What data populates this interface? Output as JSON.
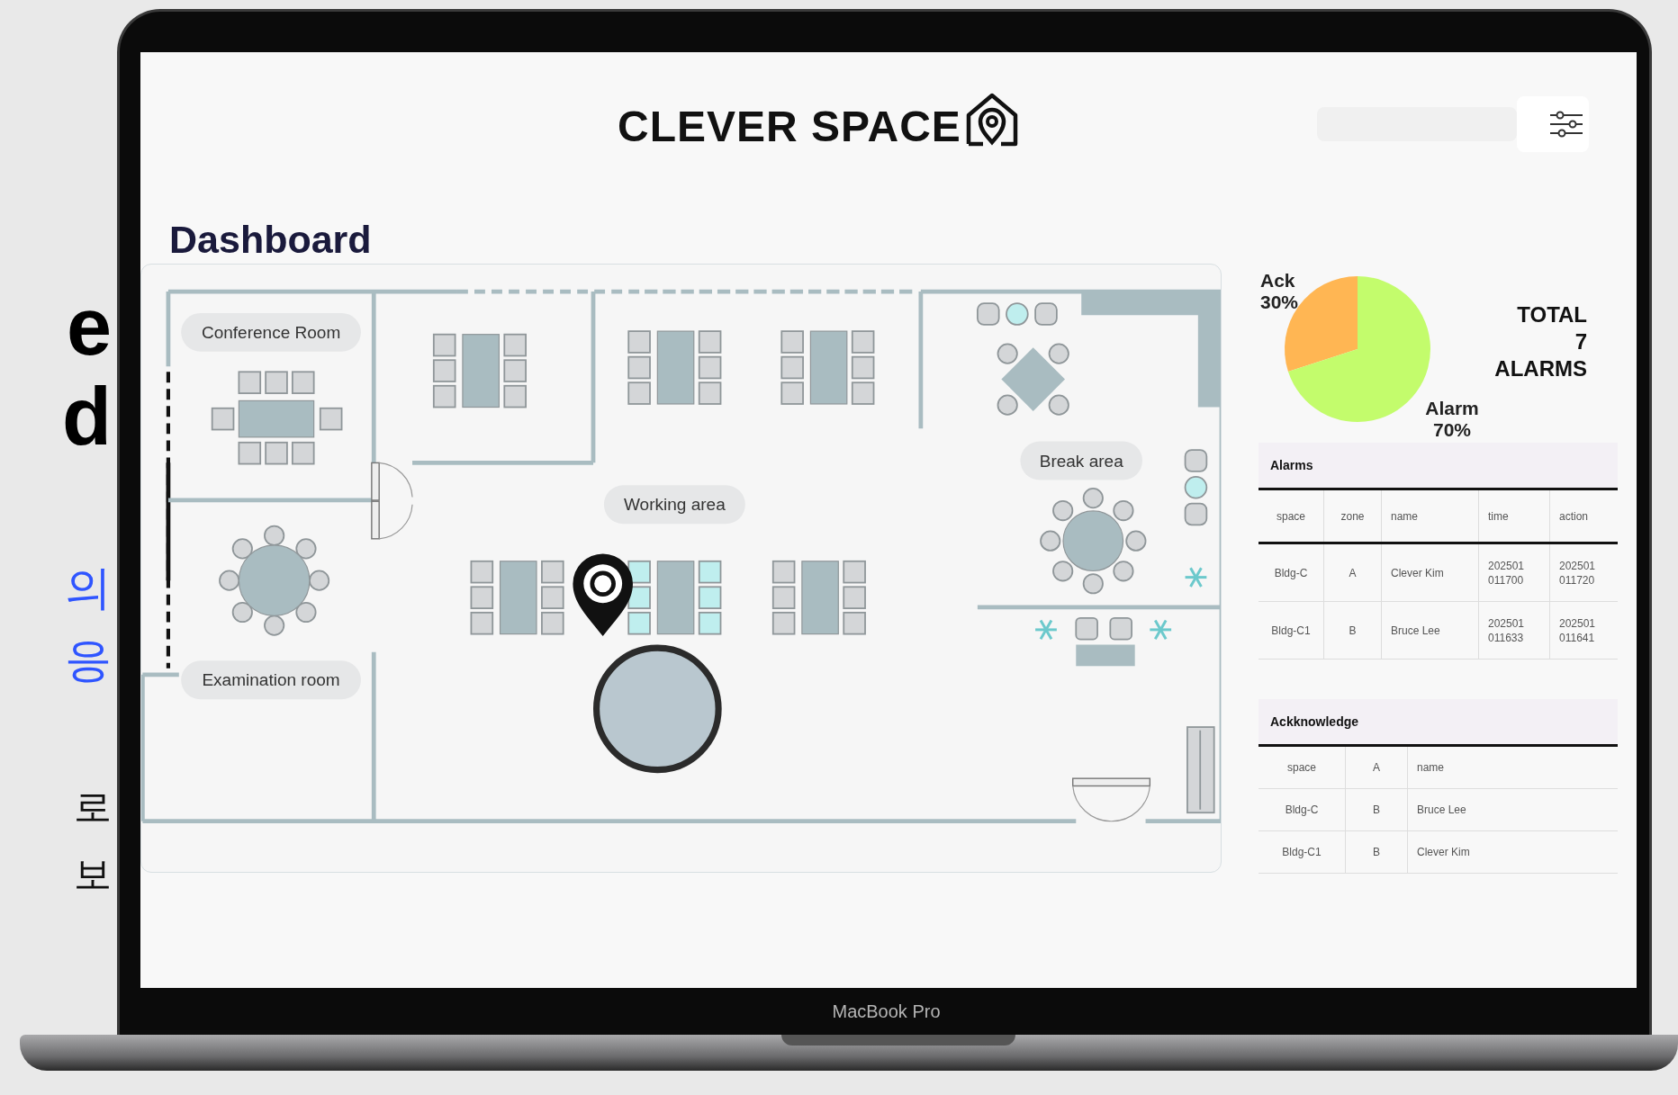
{
  "side_text": [
    {
      "text": "e",
      "kind": "heading"
    },
    {
      "text": "d",
      "kind": "heading"
    },
    {
      "text": "의",
      "kind": "link"
    },
    {
      "text": "응",
      "kind": "link"
    },
    {
      "text": "로",
      "kind": "body"
    },
    {
      "text": "보",
      "kind": "body"
    }
  ],
  "header": {
    "logo": "CLEVER SPACE"
  },
  "page_title": "Dashboard",
  "floor_plan": {
    "rooms": [
      "Conference Room",
      "Working area",
      "Break area",
      "Examination room"
    ]
  },
  "alarm_summary": {
    "chart_data": {
      "type": "pie",
      "categories": [
        "Ack",
        "Alarm"
      ],
      "values": [
        30,
        70
      ],
      "colors": [
        "#ffb653",
        "#c3fc6c"
      ],
      "value_labels": [
        "30%",
        "70%"
      ]
    },
    "total": [
      "TOTAL",
      "7",
      "ALARMS"
    ]
  },
  "alarms_table": {
    "title": "Alarms",
    "columns": [
      "space",
      "zone",
      "name",
      "time",
      "action"
    ],
    "rows": [
      [
        "Bldg-C",
        "A",
        "Clever Kim",
        "202501 011700",
        "202501 011720"
      ],
      [
        "Bldg-C1",
        "B",
        "Bruce Lee",
        "202501 011633",
        "202501 011641"
      ]
    ]
  },
  "ack_table": {
    "title": "Ackknowledge",
    "columns": [
      "space",
      "A",
      "name"
    ],
    "rows": [
      [
        "Bldg-C",
        "B",
        "Bruce Lee"
      ],
      [
        "Bldg-C1",
        "B",
        "Clever Kim"
      ]
    ]
  },
  "device_label": "MacBook Pro"
}
